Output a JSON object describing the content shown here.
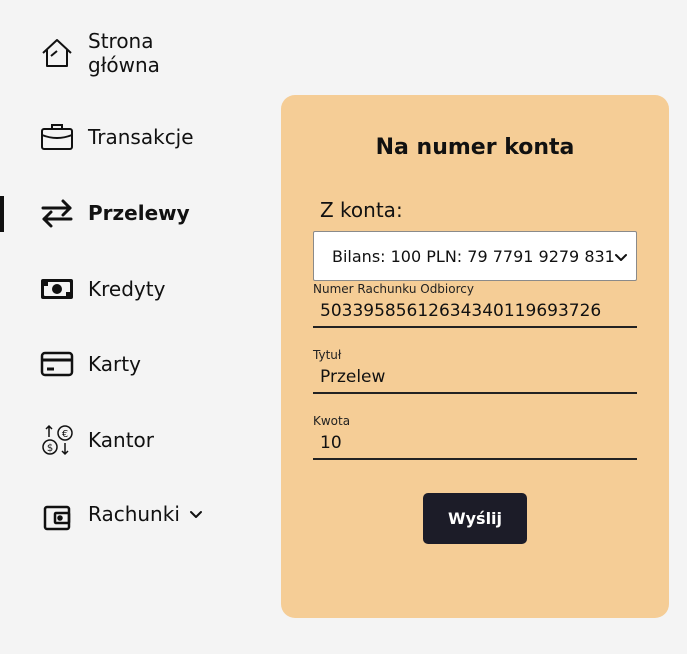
{
  "sidebar": {
    "items": [
      {
        "label": "Strona główna",
        "line1": "Strona",
        "line2": "główna",
        "icon": "home-icon"
      },
      {
        "label": "Transakcje",
        "icon": "briefcase-icon"
      },
      {
        "label": "Przelewy",
        "icon": "transfer-arrows-icon",
        "active": true
      },
      {
        "label": "Kredyty",
        "icon": "banknote-icon"
      },
      {
        "label": "Karty",
        "icon": "credit-card-icon"
      },
      {
        "label": "Kantor",
        "icon": "currency-exchange-icon"
      },
      {
        "label": "Rachunki",
        "icon": "wallet-icon",
        "expandable": true
      }
    ]
  },
  "transfer_form": {
    "title": "Na numer konta",
    "from_label": "Z konta:",
    "from_account_selected": "Bilans: 100 PLN: 79 7791 9279 831",
    "recipient_account_label": "Numer Rachunku Odbiorcy",
    "recipient_account_value": "50339585612634340119693726",
    "title_label": "Tytuł",
    "title_value": "Przelew",
    "amount_label": "Kwota",
    "amount_value": "10",
    "submit_label": "Wyślij"
  },
  "colors": {
    "background": "#f4f4f4",
    "card": "#f5cd96",
    "button": "#1c1c28",
    "text": "#111111"
  }
}
